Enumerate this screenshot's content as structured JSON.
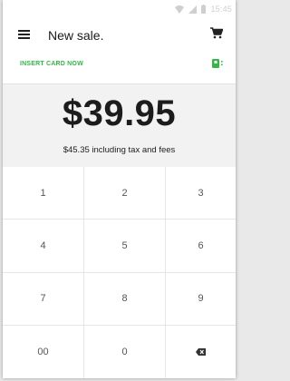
{
  "status_bar": {
    "time": "15:45",
    "icons": [
      "wifi-icon",
      "signal-icon",
      "battery-icon"
    ]
  },
  "app_bar": {
    "title": "New sale.",
    "menu_icon": "hamburger-menu-icon",
    "cart_icon": "shopping-cart-icon"
  },
  "card_prompt": {
    "label": "INSERT CARD NOW",
    "icon": "card-reader-icon",
    "accent_color": "#35b64a"
  },
  "amount": {
    "total": "$39.95",
    "subtotal_text": "$45.35 including tax and fees"
  },
  "keypad": {
    "keys": [
      {
        "label": "1",
        "name": "key-1"
      },
      {
        "label": "2",
        "name": "key-2"
      },
      {
        "label": "3",
        "name": "key-3"
      },
      {
        "label": "4",
        "name": "key-4"
      },
      {
        "label": "5",
        "name": "key-5"
      },
      {
        "label": "6",
        "name": "key-6"
      },
      {
        "label": "7",
        "name": "key-7"
      },
      {
        "label": "8",
        "name": "key-8"
      },
      {
        "label": "9",
        "name": "key-9"
      },
      {
        "label": "00",
        "name": "key-00"
      },
      {
        "label": "0",
        "name": "key-0"
      },
      {
        "label": "",
        "name": "backspace-key",
        "icon": "backspace-icon"
      }
    ]
  }
}
